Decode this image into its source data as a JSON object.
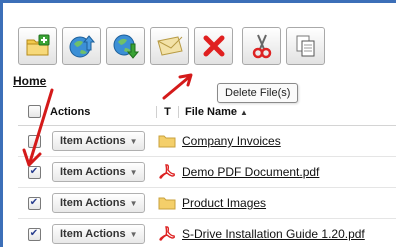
{
  "toolbar": {
    "buttons": [
      {
        "name": "new-folder-icon"
      },
      {
        "name": "upload-icon"
      },
      {
        "name": "download-icon"
      },
      {
        "name": "email-icon"
      },
      {
        "name": "delete-icon"
      },
      {
        "name": "cut-icon"
      },
      {
        "name": "copy-icon"
      }
    ]
  },
  "breadcrumb": {
    "home": "Home"
  },
  "tooltip": {
    "text": "Delete File(s)"
  },
  "table": {
    "headers": {
      "actions": "Actions",
      "type": "T",
      "name": "File Name"
    },
    "rows": [
      {
        "checked": false,
        "action": "Item Actions",
        "type_icon": "folder-icon",
        "name": "Company Invoices"
      },
      {
        "checked": true,
        "action": "Item Actions",
        "type_icon": "pdf-icon",
        "name": "Demo PDF Document.pdf"
      },
      {
        "checked": true,
        "action": "Item Actions",
        "type_icon": "folder-icon",
        "name": "Product Images"
      },
      {
        "checked": true,
        "action": "Item Actions",
        "type_icon": "pdf-icon",
        "name": "S-Drive Installation Guide 1.20.pdf"
      }
    ]
  },
  "colors": {
    "annotation_arrow": "#d41a1a",
    "accent": "#3c6fb8",
    "delete": "#e02020"
  }
}
